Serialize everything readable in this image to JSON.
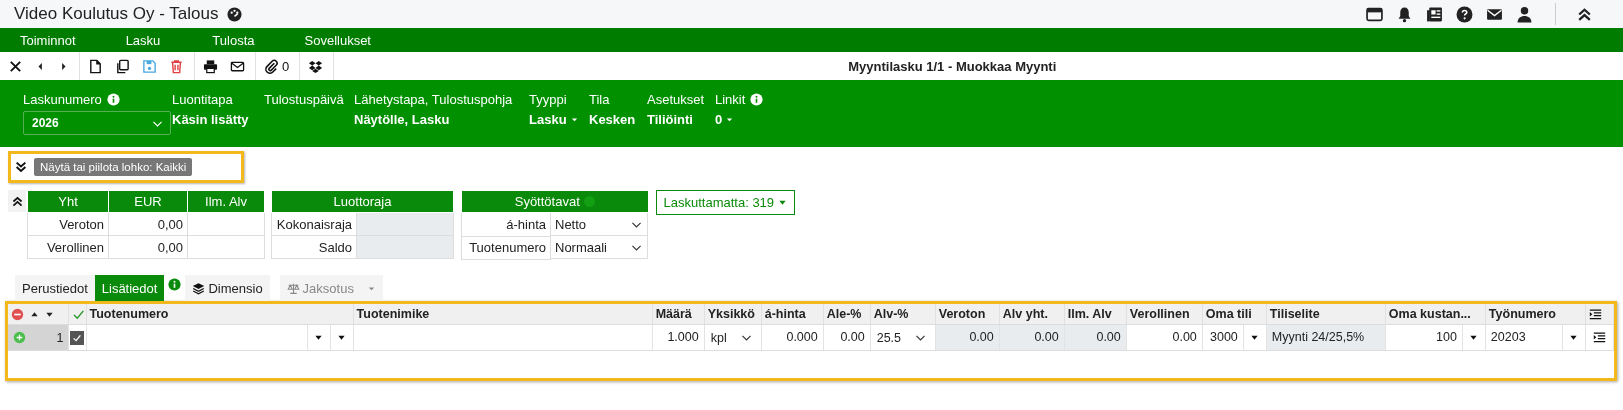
{
  "app_title": "Video Koulutus Oy - Talous",
  "menu": [
    "Toiminnot",
    "Lasku",
    "Tulosta",
    "Sovellukset"
  ],
  "toolbar": {
    "attachments": "0",
    "title": "Myyntilasku 1/1 - Muokkaa Myynti"
  },
  "header_fields": [
    {
      "label": "Laskunumero",
      "kind": "select",
      "value": "2026",
      "info": true
    },
    {
      "label": "Luontitapa",
      "kind": "text",
      "value": "Käsin lisätty"
    },
    {
      "label": "Tulostuspäivä",
      "kind": "text"
    },
    {
      "label": "Lähetystapa, Tulostuspohja",
      "kind": "text",
      "value": "Näytölle, Lasku"
    },
    {
      "label": "Tyyppi",
      "kind": "dropdown",
      "value": "Lasku"
    },
    {
      "label": "Tila",
      "kind": "text",
      "value": "Kesken"
    },
    {
      "label": "Asetukset",
      "kind": "text",
      "value": "Tiliöinti"
    },
    {
      "label": "Linkit",
      "kind": "dropdown",
      "value": "0",
      "info": true
    }
  ],
  "block_toggle": {
    "tooltip": "Näytä tai piilota lohko: Kaikki",
    "highlighted": true
  },
  "totals": {
    "columns": [
      "Yht",
      "EUR",
      "Ilm. Alv"
    ],
    "rows": [
      {
        "label": "Veroton",
        "eur": "0,00"
      },
      {
        "label": "Verollinen",
        "eur": "0,00"
      }
    ]
  },
  "credit_limit": {
    "title": "Luottoraja",
    "rows": [
      {
        "label": "Kokonaisraja"
      },
      {
        "label": "Saldo"
      }
    ]
  },
  "input_modes": {
    "title": "Syöttötavat",
    "rows": [
      {
        "label": "á-hinta",
        "value": "Netto"
      },
      {
        "label": "Tuotenumero",
        "value": "Normaali"
      }
    ]
  },
  "unbilled_button": "Laskuttamatta: 319",
  "tabs": [
    {
      "label": "Perustiedot",
      "kind": "tab",
      "selected": false,
      "disabled": false
    },
    {
      "label": "Lisätiedot",
      "kind": "tab",
      "selected": true,
      "disabled": false
    },
    {
      "kind": "info"
    },
    {
      "label": "Dimensio",
      "kind": "layers",
      "selected": false,
      "disabled": false
    },
    {
      "label": "Jaksotus",
      "kind": "scale",
      "selected": false,
      "disabled": true
    }
  ],
  "grid": {
    "highlighted": true,
    "columns": [
      "Tuotenumero",
      "Tuotenimike",
      "Määrä",
      "Yksikkö",
      "á-hinta",
      "Ale-%",
      "Alv-%",
      "Veroton",
      "Alv yht.",
      "Ilm. Alv",
      "Verollinen",
      "Oma tili",
      "Tiliselite",
      "Oma kustan...",
      "Työnumero"
    ],
    "rows": [
      {
        "number": "1",
        "checked": true,
        "cells": [
          {
            "kind": "combo2"
          },
          {
            "kind": "input"
          },
          {
            "kind": "input",
            "value": "1.000"
          },
          {
            "kind": "select",
            "value": "kpl"
          },
          {
            "kind": "input",
            "value": "0.000"
          },
          {
            "kind": "input",
            "value": "0.00"
          },
          {
            "kind": "select",
            "value": "25.5"
          },
          {
            "kind": "readonly",
            "value": "0.00"
          },
          {
            "kind": "readonly",
            "value": "0.00"
          },
          {
            "kind": "readonly",
            "value": "0.00"
          },
          {
            "kind": "input",
            "value": "0.00"
          },
          {
            "kind": "combo",
            "value": "3000"
          },
          {
            "kind": "readonly-left",
            "value": "Myynti 24/25,5%"
          },
          {
            "kind": "combo",
            "value": "100"
          },
          {
            "kind": "combo-left",
            "value": "20203"
          }
        ]
      }
    ]
  }
}
